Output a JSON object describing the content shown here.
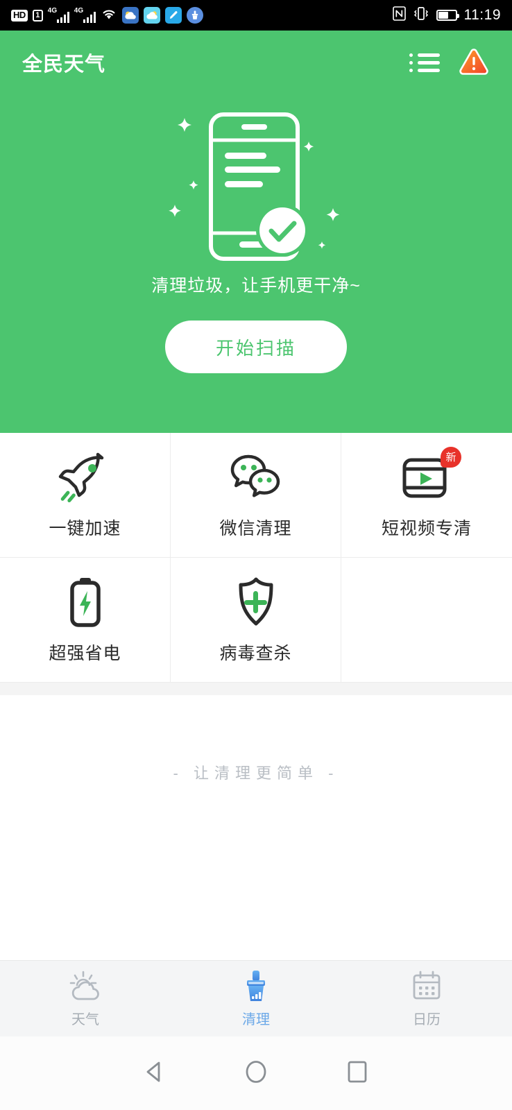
{
  "statusbar": {
    "hd_label": "HD",
    "sim_label": "1",
    "network1": "4G",
    "network2": "4G",
    "icons": [
      "hd-icon",
      "sim1-icon",
      "signal-4g-icon",
      "signal-4g-icon",
      "wifi-icon",
      "weather-app-icon",
      "weather-app-icon-2",
      "pen-app-icon",
      "cleaner-app-icon",
      "nfc-icon",
      "vibrate-icon",
      "battery-icon"
    ],
    "time": "11:19"
  },
  "header": {
    "title": "全民天气",
    "list_icon": "list-icon",
    "warning_icon": "warning-triangle-icon"
  },
  "hero": {
    "illustration": "phone-clean-check-illustration",
    "tagline": "清理垃圾，让手机更干净~",
    "scan_button": "开始扫描",
    "accent_color": "#4CC56F"
  },
  "features": [
    {
      "label": "一键加速",
      "icon": "rocket-icon",
      "badge": null
    },
    {
      "label": "微信清理",
      "icon": "wechat-bubbles-icon",
      "badge": null
    },
    {
      "label": "短视频专清",
      "icon": "video-player-icon",
      "badge": "新"
    },
    {
      "label": "超强省电",
      "icon": "battery-bolt-icon",
      "badge": null
    },
    {
      "label": "病毒查杀",
      "icon": "shield-plus-icon",
      "badge": null
    }
  ],
  "content": {
    "slogan": "- 让清理更简单 -"
  },
  "tabbar": {
    "active_color": "#6ba8e8",
    "inactive_color": "#a6adb4",
    "items": [
      {
        "label": "天气",
        "icon": "sun-cloud-icon",
        "active": false
      },
      {
        "label": "清理",
        "icon": "broom-icon",
        "active": true
      },
      {
        "label": "日历",
        "icon": "calendar-icon",
        "active": false
      }
    ]
  },
  "androidnav": {
    "back": "back-triangle-icon",
    "home": "home-circle-icon",
    "recent": "recent-square-icon"
  }
}
